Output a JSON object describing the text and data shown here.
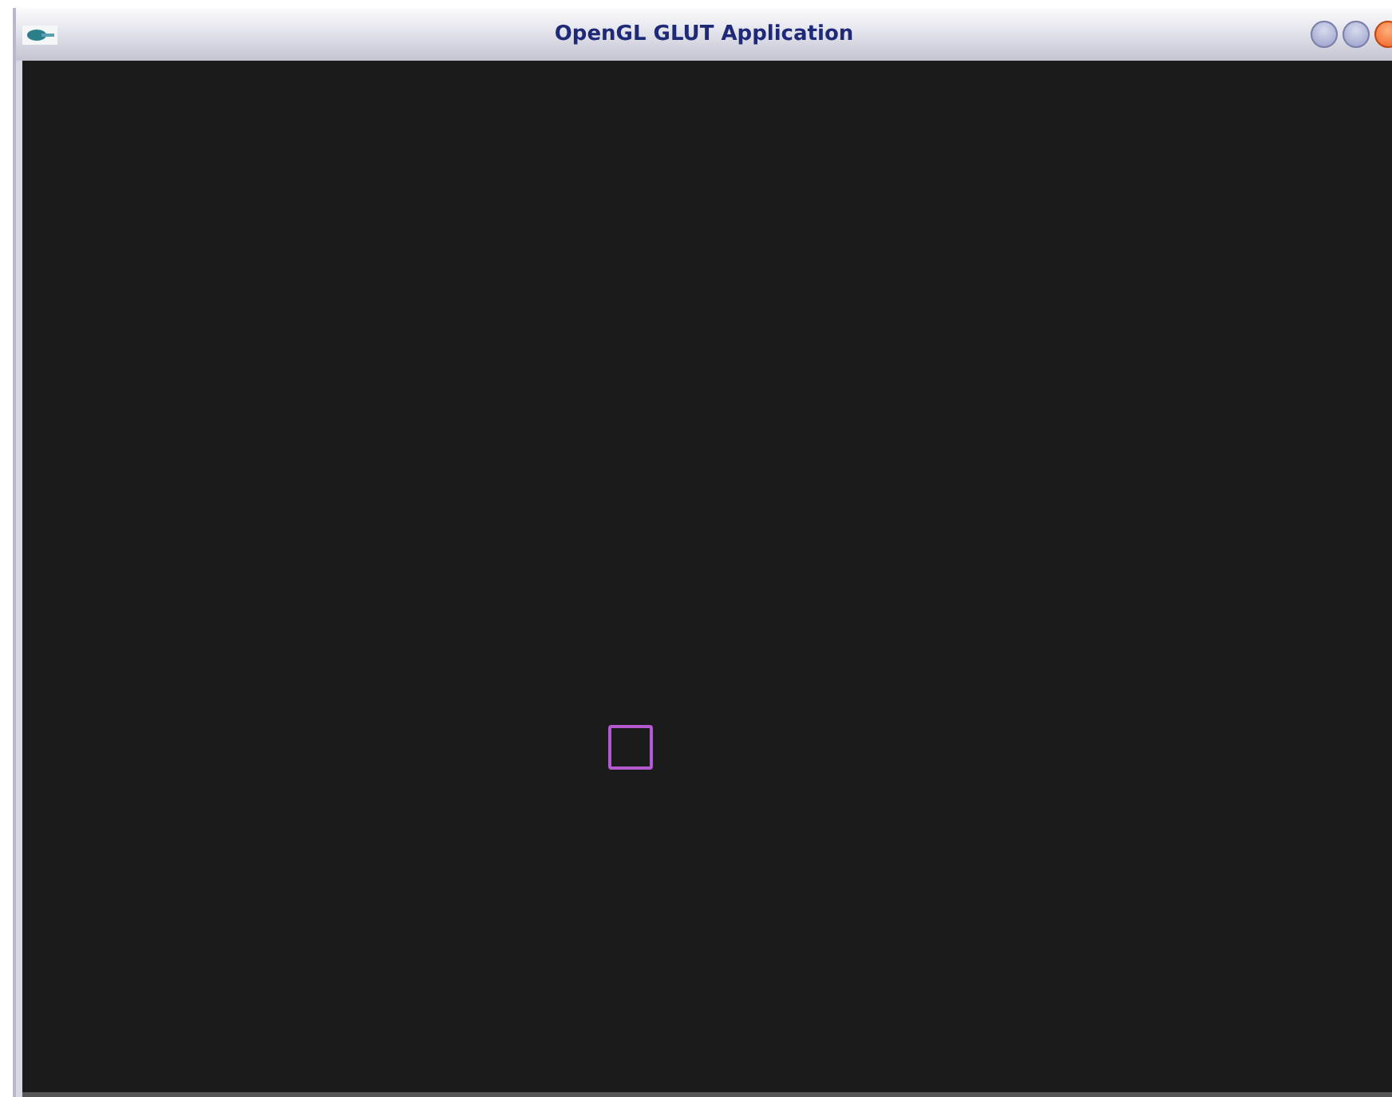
{
  "window": {
    "title": "OpenGL GLUT Application"
  }
}
